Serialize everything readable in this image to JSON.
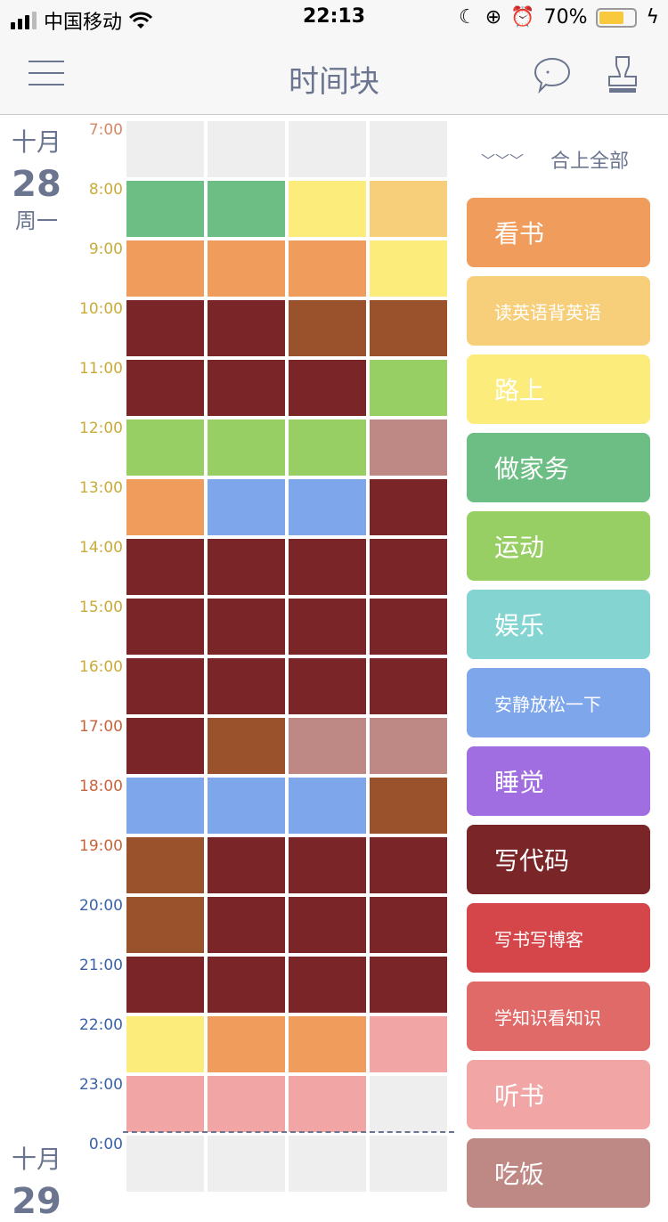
{
  "status": {
    "carrier": "中国移动",
    "time": "22:13",
    "battery": "70%"
  },
  "header": {
    "title": "时间块",
    "icons": [
      "menu-icon",
      "chat-bubble-icon",
      "stamp-icon"
    ]
  },
  "dates": [
    {
      "month": "十月",
      "day": "28",
      "weekday": "周一"
    },
    {
      "month": "十月",
      "day": "29"
    }
  ],
  "times": [
    {
      "label": "7:00",
      "color": "#d4886a"
    },
    {
      "label": "8:00",
      "color": "#c9ab3a"
    },
    {
      "label": "9:00",
      "color": "#c9ab3a"
    },
    {
      "label": "10:00",
      "color": "#c9ab3a"
    },
    {
      "label": "11:00",
      "color": "#c9ab3a"
    },
    {
      "label": "12:00",
      "color": "#c9ab3a"
    },
    {
      "label": "13:00",
      "color": "#c9ab3a"
    },
    {
      "label": "14:00",
      "color": "#c9ab3a"
    },
    {
      "label": "15:00",
      "color": "#c9ab3a"
    },
    {
      "label": "16:00",
      "color": "#c9ab3a"
    },
    {
      "label": "17:00",
      "color": "#c8643c"
    },
    {
      "label": "18:00",
      "color": "#c8643c"
    },
    {
      "label": "19:00",
      "color": "#c8643c"
    },
    {
      "label": "20:00",
      "color": "#3a62a8"
    },
    {
      "label": "21:00",
      "color": "#3a62a8"
    },
    {
      "label": "22:00",
      "color": "#3a62a8"
    },
    {
      "label": "23:00",
      "color": "#3a62a8"
    },
    {
      "label": "0:00",
      "color": "#3a62a8"
    }
  ],
  "palette": {
    "E": "#eeeeee",
    "O": "#f09c5c",
    "LO": "#f7ce7a",
    "Y": "#fbec7c",
    "G": "#6dbe85",
    "LG": "#98cf65",
    "B": "#7ea6eb",
    "D": "#7a2628",
    "Br": "#9a522c",
    "M": "#be8985",
    "P": "#f2a5a5"
  },
  "grid": [
    [
      "E",
      "E",
      "E",
      "E"
    ],
    [
      "G",
      "G",
      "Y",
      "LO"
    ],
    [
      "O",
      "O",
      "O",
      "Y"
    ],
    [
      "D",
      "D",
      "Br",
      "Br"
    ],
    [
      "D",
      "D",
      "D",
      "LG"
    ],
    [
      "LG",
      "LG",
      "LG",
      "M"
    ],
    [
      "O",
      "B",
      "B",
      "D"
    ],
    [
      "D",
      "D",
      "D",
      "D"
    ],
    [
      "D",
      "D",
      "D",
      "D"
    ],
    [
      "D",
      "D",
      "D",
      "D"
    ],
    [
      "D",
      "Br",
      "M",
      "M"
    ],
    [
      "B",
      "B",
      "B",
      "Br"
    ],
    [
      "Br",
      "D",
      "D",
      "D"
    ],
    [
      "Br",
      "D",
      "D",
      "D"
    ],
    [
      "D",
      "D",
      "D",
      "D"
    ],
    [
      "Y",
      "O",
      "O",
      "P"
    ],
    [
      "P",
      "P",
      "P",
      "E"
    ],
    [
      "E",
      "E",
      "E",
      "E"
    ]
  ],
  "sidebar": {
    "collapse_icon": "﹀﹀﹀",
    "collapse_label": "合上全部",
    "categories": [
      {
        "label": "看书",
        "color": "#f09c5c"
      },
      {
        "label": "读英语背英语",
        "color": "#f7ce7a"
      },
      {
        "label": "路上",
        "color": "#fbec7c"
      },
      {
        "label": "做家务",
        "color": "#6dbe85"
      },
      {
        "label": "运动",
        "color": "#98cf65"
      },
      {
        "label": "娱乐",
        "color": "#84d5d2"
      },
      {
        "label": "安静放松一下",
        "color": "#7ea6eb"
      },
      {
        "label": "睡觉",
        "color": "#a06ee0"
      },
      {
        "label": "写代码",
        "color": "#7a2628"
      },
      {
        "label": "写书写博客",
        "color": "#d5464b"
      },
      {
        "label": "学知识看知识",
        "color": "#e06a67"
      },
      {
        "label": "听书",
        "color": "#f2a5a5"
      },
      {
        "label": "吃饭",
        "color": "#be8985"
      }
    ]
  }
}
